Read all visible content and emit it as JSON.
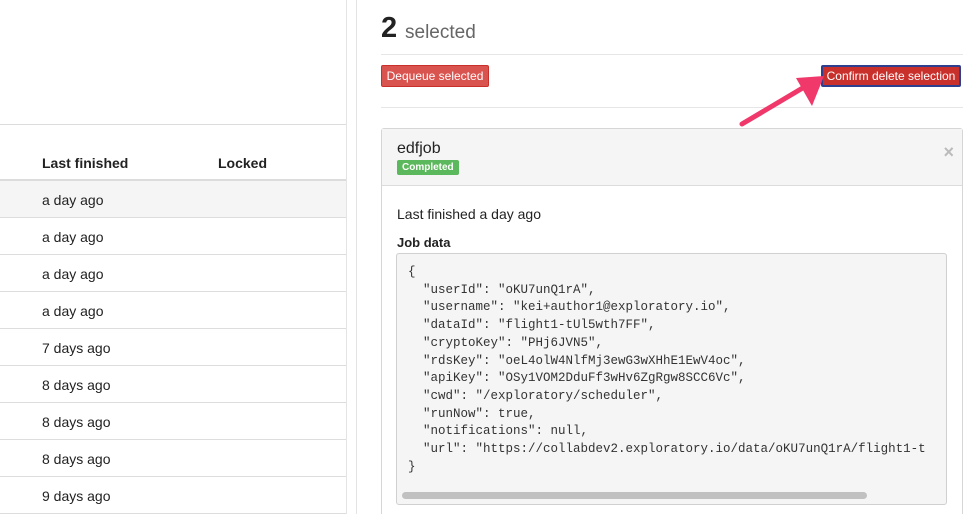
{
  "table": {
    "headers": {
      "last_finished": "Last finished",
      "locked": "Locked"
    },
    "rows": [
      "a day ago",
      "a day ago",
      "a day ago",
      "a day ago",
      "7 days ago",
      "8 days ago",
      "8 days ago",
      "8 days ago",
      "9 days ago"
    ]
  },
  "selection": {
    "count": "2",
    "label": "selected",
    "dequeue_label": "Dequeue selected",
    "confirm_label": "Confirm delete selection"
  },
  "job": {
    "name": "edfjob",
    "status": "Completed",
    "close": "×",
    "last_finished": "Last finished a day ago",
    "data_label": "Job data",
    "code": "{\n  \"userId\": \"oKU7unQ1rA\",\n  \"username\": \"kei+author1@exploratory.io\",\n  \"dataId\": \"flight1-tUl5wth7FF\",\n  \"cryptoKey\": \"PHj6JVN5\",\n  \"rdsKey\": \"oeL4olW4NlfMj3ewG3wXHhE1EwV4oc\",\n  \"apiKey\": \"OSy1VOM2DduFf3wHv6ZgRgw8SCC6Vc\",\n  \"cwd\": \"/exploratory/scheduler\",\n  \"runNow\": true,\n  \"notifications\": null,\n  \"url\": \"https://collabdev2.exploratory.io/data/oKU7unQ1rA/flight1-t\n}"
  },
  "colors": {
    "danger": "#d9534f",
    "success": "#5cb85c",
    "arrow": "#f0386b"
  },
  "icons": {
    "arrow": "pink-arrow-icon",
    "close": "close-icon"
  }
}
